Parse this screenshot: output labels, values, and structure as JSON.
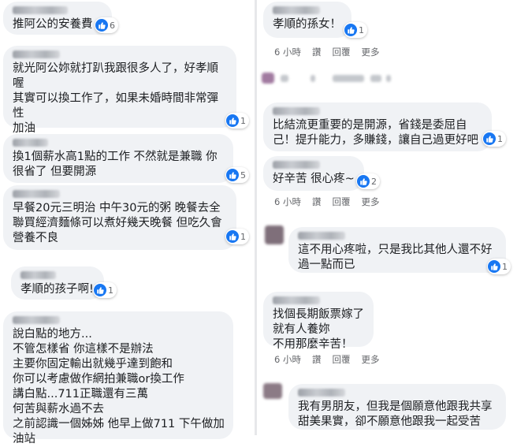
{
  "left": {
    "comments": [
      {
        "lines": [
          "推阿公的安養費"
        ],
        "reactions": "6"
      },
      {
        "lines": [
          "就光阿公妳就打趴我跟很多人了，好孝順",
          "喔",
          "其實可以換工作了，如果未婚時間非常彈",
          "性",
          "加油"
        ],
        "reactions": "1"
      },
      {
        "lines": [
          "換1個薪水高1點的工作 不然就是兼職 你",
          "很省了 但要開源"
        ],
        "reactions": "5"
      },
      {
        "lines": [
          "早餐20元三明治 中午30元的粥 晚餐去全",
          "聯買經濟麵條可以煮好幾天晚餐 但吃久會",
          "營養不良"
        ],
        "reactions": "1"
      },
      {
        "lines": [
          "孝順的孩子啊!!!"
        ],
        "reactions": "1"
      },
      {
        "lines": [
          "說白點的地方...",
          "不管怎樣省 你這樣不是辦法",
          "主要你固定輸出就幾乎達到飽和",
          "你可以考慮做作網拍兼職or換工作",
          "講白點...711正職還有三萬",
          "何苦與薪水過不去",
          "之前認識一個姊姊 他早上做711 下午做加",
          "油站"
        ],
        "reactions": ""
      }
    ]
  },
  "right": {
    "comments": [
      {
        "lines": [
          "孝順的孫女！"
        ],
        "reactions": "1"
      },
      {
        "lines": [
          "比結流更重要的是開源，省錢是委屈自",
          "己！提升能力，多賺錢，讓自己過更好吧"
        ],
        "reactions": "1"
      },
      {
        "lines": [
          "好辛苦 很心疼~"
        ],
        "reactions": "2"
      },
      {
        "lines": [
          "這不用心疼啦，只是我比其他人還不好",
          "過一點而已"
        ],
        "reactions": "1"
      },
      {
        "lines": [
          "找個長期飯票嫁了",
          "就有人養妳",
          "不用那麼辛苦！"
        ],
        "reactions": ""
      },
      {
        "lines": [
          "我有男朋友，但我是個願意他跟我共享",
          "甜美果實，卻不願意他跟我一起受苦"
        ],
        "reactions": ""
      }
    ],
    "meta": {
      "time": "6 小時",
      "read": "讚",
      "reply": "回覆",
      "more": "更多"
    }
  }
}
